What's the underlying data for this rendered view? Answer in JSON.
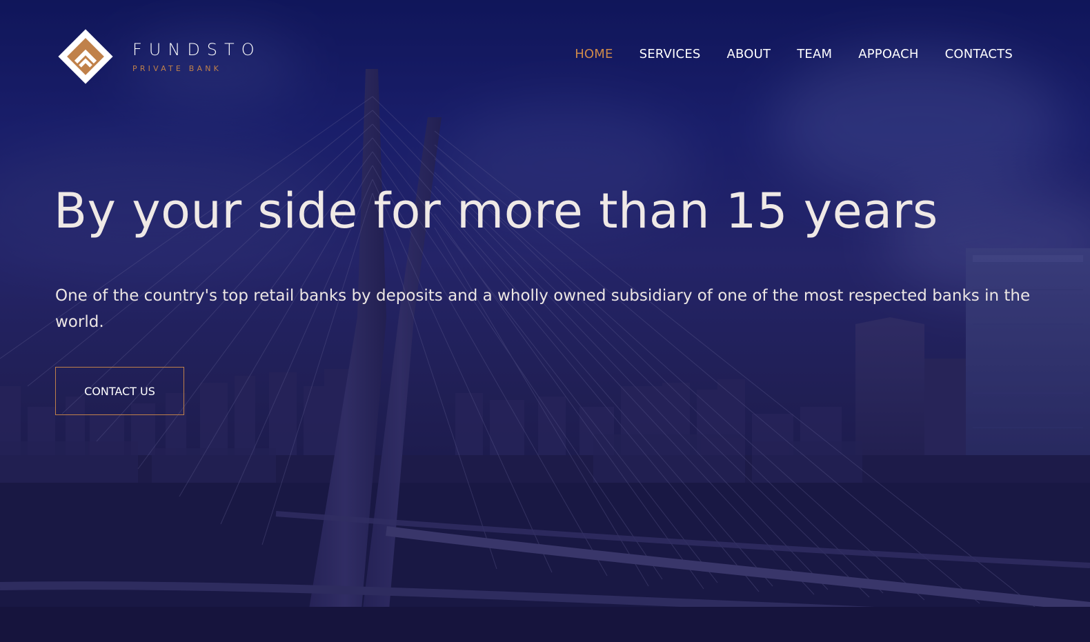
{
  "brand": {
    "name": "FUNDSTO",
    "tagline": "PRIVATE BANK",
    "accent_color": "#c0814a"
  },
  "nav": {
    "items": [
      {
        "label": "HOME",
        "active": true
      },
      {
        "label": "SERVICES",
        "active": false
      },
      {
        "label": "ABOUT",
        "active": false
      },
      {
        "label": "TEAM",
        "active": false
      },
      {
        "label": "APPOACH",
        "active": false
      },
      {
        "label": "CONTACTS",
        "active": false
      }
    ]
  },
  "hero": {
    "headline": "By your side for more than 15 years",
    "subtext": "One of the country's top retail banks by deposits and a wholly owned subsidiary of one of the most respected banks in the world.",
    "cta_label": "CONTACT US",
    "background_image": "city-bridge-skyline"
  },
  "colors": {
    "overlay": "#1a1b5e",
    "text": "#ffffff",
    "active_nav": "#cf8a4a"
  }
}
